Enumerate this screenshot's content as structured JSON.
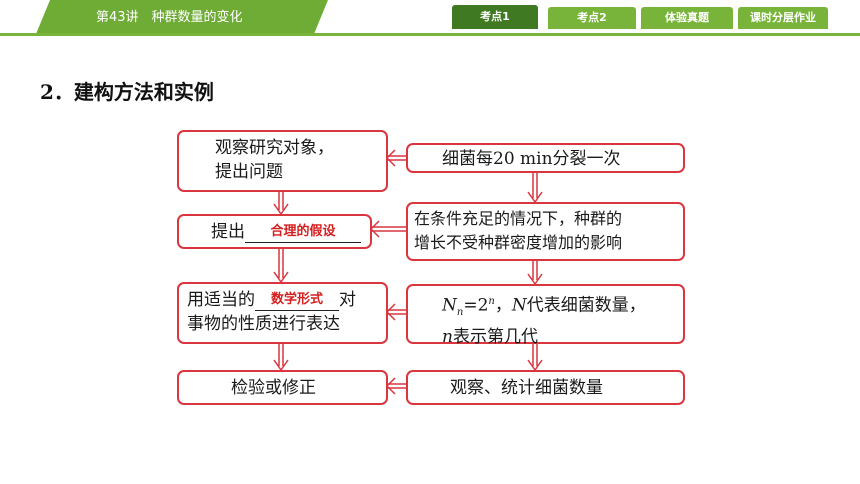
{
  "header": {
    "title": "第43讲　种群数量的变化",
    "tabs": [
      {
        "label": "考点1",
        "active": true
      },
      {
        "label": "考点2",
        "active": false
      },
      {
        "label": "体验真题",
        "active": false
      },
      {
        "label": "课时分层作业",
        "active": false
      }
    ]
  },
  "section": {
    "heading": "2．建构方法和实例"
  },
  "flow": {
    "left": {
      "step1_line1": "观察研究对象，",
      "step1_line2": "提出问题",
      "step2_prefix": "提出",
      "step2_answer": "合理的假设",
      "step3_prefix": "用适当的",
      "step3_answer": "数学形式",
      "step3_suffix": "对",
      "step3_line2": "事物的性质进行表达",
      "step4": "检验或修正"
    },
    "right": {
      "step1": "细菌每20 min分裂一次",
      "step2_line1": "在条件充足的情况下，种群的",
      "step2_line2": "增长不受种群密度增加的影响",
      "step3_N": "N",
      "step3_sub": "n",
      "step3_eq": "=2",
      "step3_sup": "n",
      "step3_comma": "，",
      "step3_N2": "N",
      "step3_rest": "代表细菌数量，",
      "step3_n": "n",
      "step3_line2_rest": "表示第几代",
      "step4": "观察、统计细菌数量"
    }
  },
  "colors": {
    "header_green": "#6fac36",
    "active_tab": "#3f7a22",
    "box_border": "#d93640",
    "answer_red": "#d32020"
  }
}
